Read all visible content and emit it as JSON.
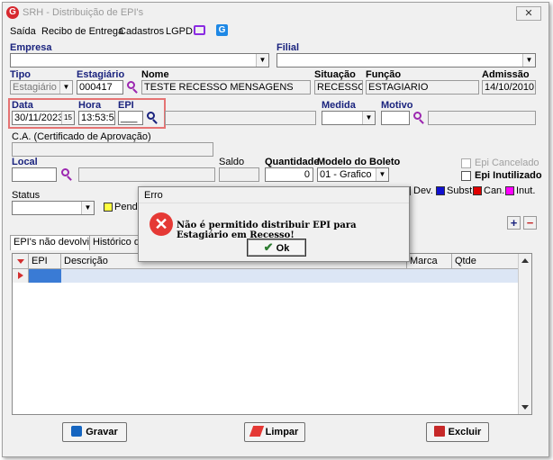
{
  "window": {
    "title": "SRH - Distribuição de EPI's",
    "close": "✕"
  },
  "menu": {
    "items": [
      "Saída",
      "Recibo de Entrega",
      "Cadastros",
      "LGPD"
    ]
  },
  "form": {
    "empresa_label": "Empresa",
    "filial_label": "Filial",
    "tipo_label": "Tipo",
    "tipo_value": "Estagiário",
    "estagiario_label": "Estagiário",
    "estagiario_value": "000417",
    "nome_label": "Nome",
    "nome_value": "TESTE RECESSO MENSAGENS",
    "situacao_label": "Situação",
    "situacao_value": "RECESSO",
    "funcao_label": "Função",
    "funcao_value": "ESTAGIARIO",
    "admissao_label": "Admissão",
    "admissao_value": "14/10/2010",
    "data_label": "Data",
    "data_value": "30/11/2023",
    "hora_label": "Hora",
    "hora_value": "13:53:59",
    "epi_label": "EPI",
    "epi_value": "___",
    "medida_label": "Medida",
    "motivo_label": "Motivo",
    "ca_label": "C.A. (Certificado de Aprovação)",
    "local_label": "Local",
    "saldo_label": "Saldo",
    "quantidade_label": "Quantidade",
    "quantidade_value": "0",
    "modelo_label": "Modelo do Boleto",
    "modelo_value": "01 - Grafico",
    "epi_cancelado_label": "Epi Cancelado",
    "epi_inutilizado_label": "Epi Inutilizado",
    "status_label": "Status",
    "status_legend": "Pende"
  },
  "legend": [
    {
      "label": "Dev.",
      "color": "#00a000"
    },
    {
      "label": "Subst.",
      "color": "#1010d0"
    },
    {
      "label": "Can.",
      "color": "#e00000"
    },
    {
      "label": "Inut.",
      "color": "#ff00ff"
    }
  ],
  "tabs": [
    "EPI's não devolvidos",
    "Histórico das"
  ],
  "grid": {
    "columns": [
      "EPI",
      "Descrição",
      "Marca",
      "Qtde"
    ]
  },
  "buttons": {
    "gravar": "Gravar",
    "limpar": "Limpar",
    "excluir": "Excluir",
    "add": "+",
    "remove": "−"
  },
  "dialog": {
    "title": "Erro",
    "message": "Não é permitido distribuir EPI para Estagiário em Recesso!",
    "ok": "Ok"
  }
}
